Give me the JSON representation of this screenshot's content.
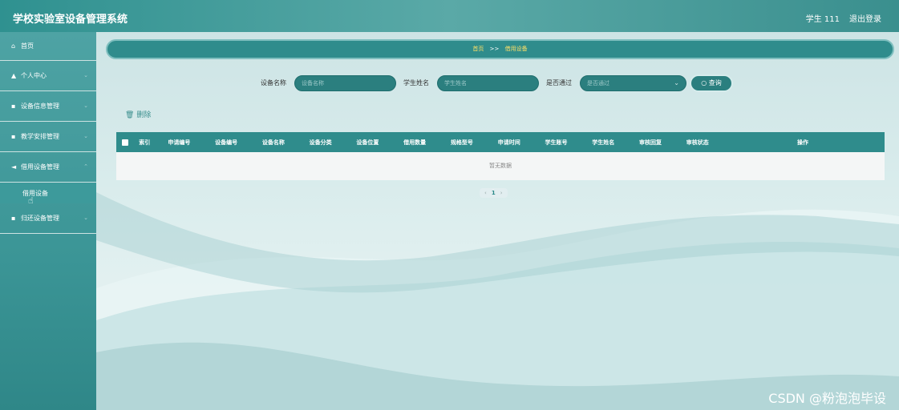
{
  "header": {
    "app_title": "学校实验室设备管理系统",
    "user_label": "学生 111",
    "logout_label": "退出登录"
  },
  "sidebar": {
    "items": [
      {
        "label": "首页",
        "icon": "home-icon"
      },
      {
        "label": "个人中心",
        "icon": "user-icon"
      },
      {
        "label": "设备信息管理",
        "icon": "grid-icon"
      },
      {
        "label": "教学安排管理",
        "icon": "grid-icon"
      },
      {
        "label": "借用设备管理",
        "icon": "send-icon"
      },
      {
        "label": "归还设备管理",
        "icon": "grid-icon"
      }
    ],
    "active_sub": "借用设备"
  },
  "breadcrumb": {
    "home": "首页",
    "separator": ">>",
    "current": "借用设备"
  },
  "search": {
    "device_name_label": "设备名称",
    "device_name_placeholder": "设备名称",
    "student_name_label": "学生姓名",
    "student_name_placeholder": "学生姓名",
    "approved_label": "是否通过",
    "approved_placeholder": "是否通过",
    "query_label": "查询"
  },
  "actions": {
    "delete_label": "删除"
  },
  "table": {
    "columns": [
      "索引",
      "申请编号",
      "设备编号",
      "设备名称",
      "设备分类",
      "设备位置",
      "借用数量",
      "规格型号",
      "申请时间",
      "学生账号",
      "学生姓名",
      "审核回复",
      "审核状态",
      "操作"
    ],
    "empty_text": "暂无数据"
  },
  "pagination": {
    "current_page": "1"
  },
  "watermark": "CSDN @粉泡泡毕设",
  "colors": {
    "accent": "#2f8c8c",
    "highlight": "#ffe066"
  }
}
